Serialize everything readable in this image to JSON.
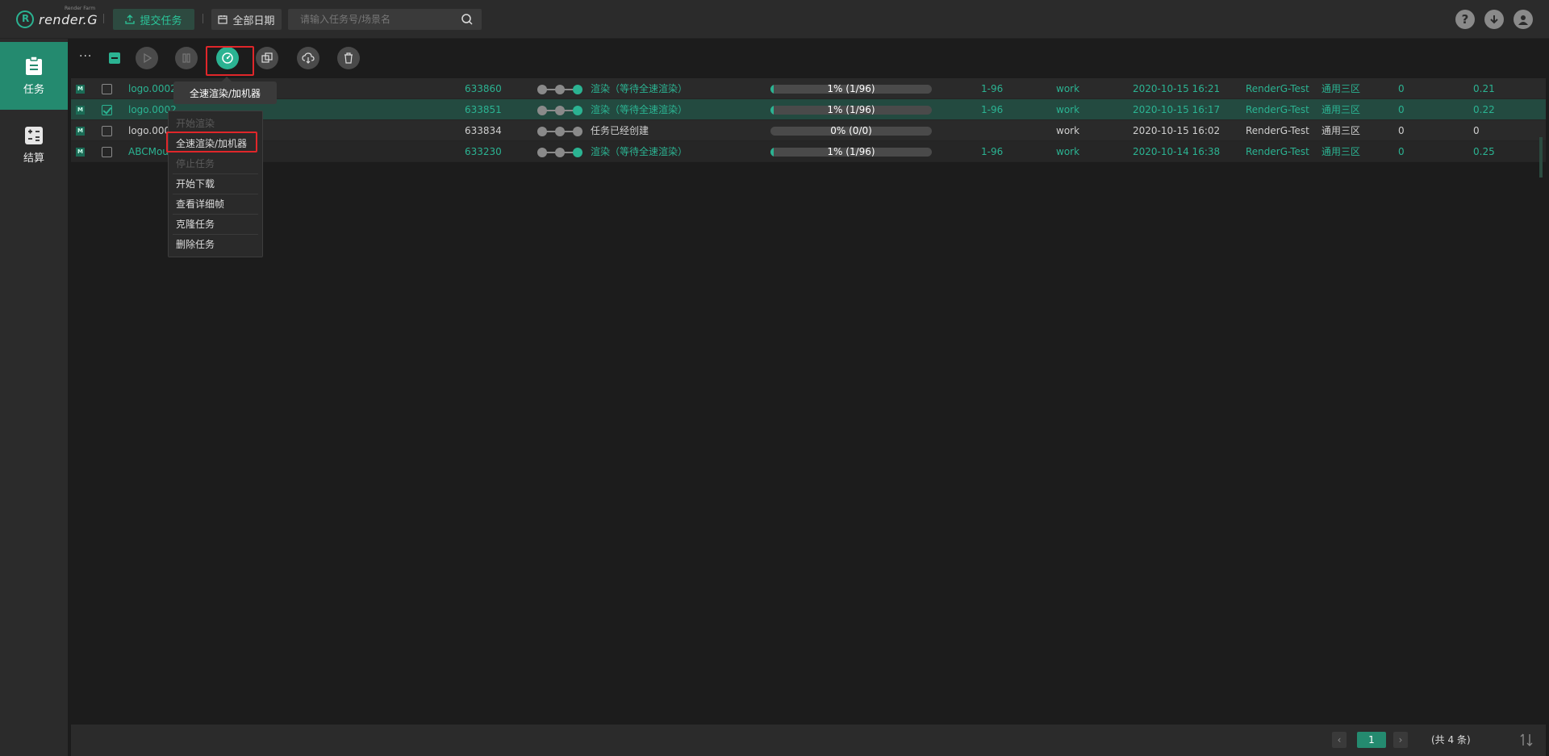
{
  "header": {
    "logo_text": "render.G",
    "logo_sub": "Render Farm",
    "submit_label": "提交任务",
    "date_label": "全部日期",
    "search_placeholder": "请输入任务号/场景名"
  },
  "sidebar": {
    "items": [
      {
        "label": "任务",
        "active": true
      },
      {
        "label": "结算",
        "active": false
      }
    ]
  },
  "toolbar": {
    "more": "···",
    "tooltip": "全速渲染/加机器"
  },
  "rows": [
    {
      "name": "logo.0002",
      "id": "633860",
      "status": "渲染（等待全速渲染）",
      "progress_text": "1% (1/96)",
      "progress": 0.01,
      "frames": "1-96",
      "project": "work",
      "time": "2020-10-15 16:21",
      "user": "RenderG-Test",
      "zone": "通用三区",
      "count": "0",
      "cost": "0.21",
      "checked": false,
      "teal": true
    },
    {
      "name": "logo.0002",
      "id": "633851",
      "status": "渲染（等待全速渲染）",
      "progress_text": "1% (1/96)",
      "progress": 0.01,
      "frames": "1-96",
      "project": "work",
      "time": "2020-10-15 16:17",
      "user": "RenderG-Test",
      "zone": "通用三区",
      "count": "0",
      "cost": "0.22",
      "checked": true,
      "teal": true
    },
    {
      "name": "logo.000",
      "id": "633834",
      "status": "任务已经创建",
      "progress_text": "0% (0/0)",
      "progress": 0.0,
      "frames": "",
      "project": "work",
      "time": "2020-10-15 16:02",
      "user": "RenderG-Test",
      "zone": "通用三区",
      "count": "0",
      "cost": "0",
      "checked": false,
      "teal": false
    },
    {
      "name": "ABCMou",
      "id": "633230",
      "status": "渲染（等待全速渲染）",
      "progress_text": "1% (1/96)",
      "progress": 0.01,
      "frames": "1-96",
      "project": "work",
      "time": "2020-10-14 16:38",
      "user": "RenderG-Test",
      "zone": "通用三区",
      "count": "0",
      "cost": "0.25",
      "checked": false,
      "teal": true
    }
  ],
  "context_menu": {
    "items": [
      {
        "label": "开始渲染",
        "disabled": true
      },
      {
        "label": "全速渲染/加机器",
        "disabled": false
      },
      {
        "label": "停止任务",
        "disabled": true
      },
      {
        "label": "开始下载",
        "disabled": false
      },
      {
        "label": "查看详细帧",
        "disabled": false
      },
      {
        "label": "克隆任务",
        "disabled": false
      },
      {
        "label": "删除任务",
        "disabled": false
      }
    ]
  },
  "pagination": {
    "current": "1",
    "total_text": "(共 4 条)"
  },
  "colors": {
    "accent": "#2bb392",
    "highlight": "#e0262a"
  }
}
